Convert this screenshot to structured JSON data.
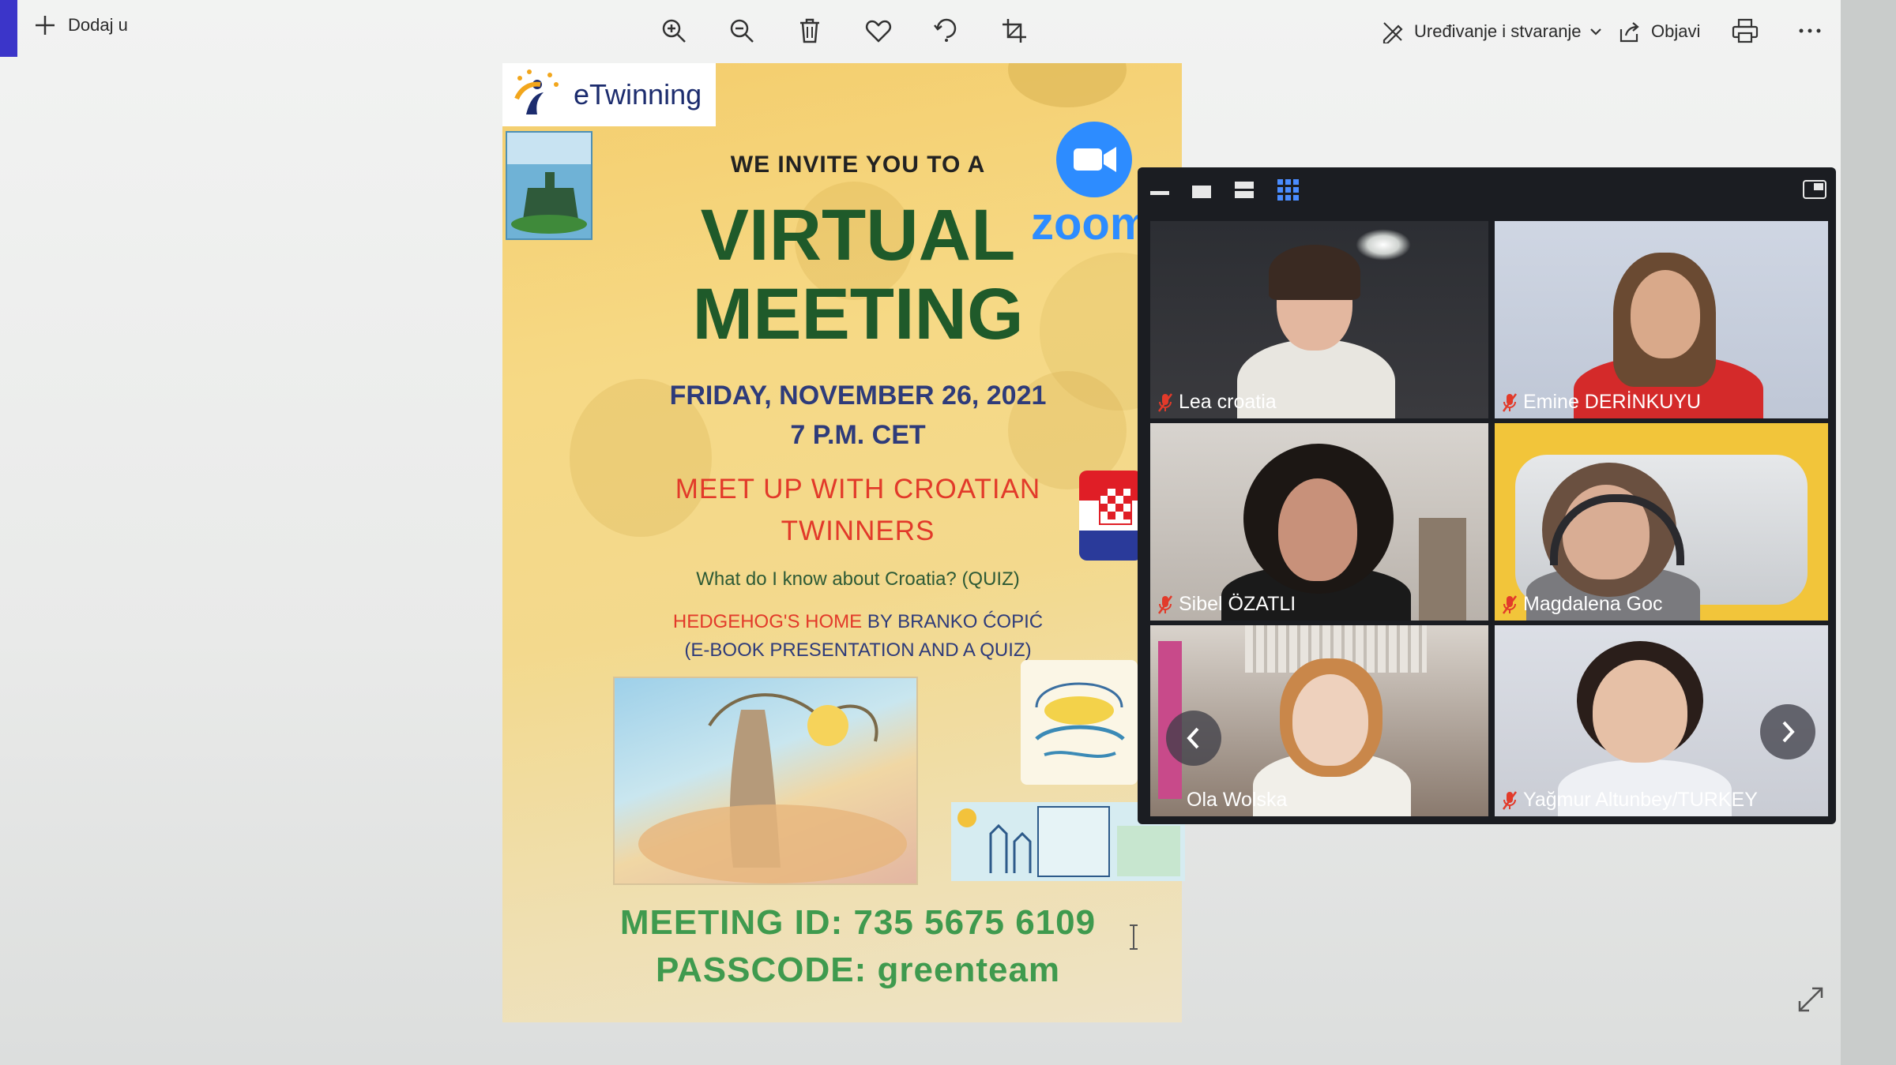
{
  "toolbar": {
    "add_label": "Dodaj u",
    "edit_create_label": "Uređivanje i stvaranje",
    "share_label": "Objavi",
    "icons": [
      "zoom-in-icon",
      "zoom-out-icon",
      "delete-icon",
      "heart-icon",
      "rotate-icon",
      "crop-icon",
      "print-icon",
      "more-icon"
    ]
  },
  "poster": {
    "brand": "eTwinning",
    "invite": "WE INVITE YOU TO A",
    "title_line1": "VIRTUAL",
    "title_line2": "MEETING",
    "date": "FRIDAY, NOVEMBER 26, 2021",
    "time": "7 P.M. CET",
    "meetup_line1": "MEET UP WITH CROATIAN",
    "meetup_line2": "TWINNERS",
    "quiz": "What do I know about Croatia? (QUIZ)",
    "hedgehog_title": "HEDGEHOG'S HOME",
    "hedgehog_by": "BY BRANKO ĆOPIĆ",
    "hedgehog_sub": "(E-BOOK PRESENTATION AND A QUIZ)",
    "zoom_brand": "zoom",
    "meeting_id": "MEETING ID: 735 5675 6109",
    "passcode": "PASSCODE: greenteam",
    "colors": {
      "title_green": "#1f5a2a",
      "accent_red": "#e23a2a",
      "navy": "#2e3b7a",
      "id_green": "#3f9a4e"
    }
  },
  "zoom_window": {
    "participants": [
      {
        "name": "Lea croatia",
        "muted": true
      },
      {
        "name": "Emine DERİNKUYU",
        "muted": true
      },
      {
        "name": "Sibel ÖZATLI",
        "muted": true
      },
      {
        "name": "Magdalena Goc",
        "muted": true
      },
      {
        "name": "Ola Wolska",
        "muted": true
      },
      {
        "name": "Yağmur Altunbey/TURKEY",
        "muted": true
      }
    ]
  }
}
